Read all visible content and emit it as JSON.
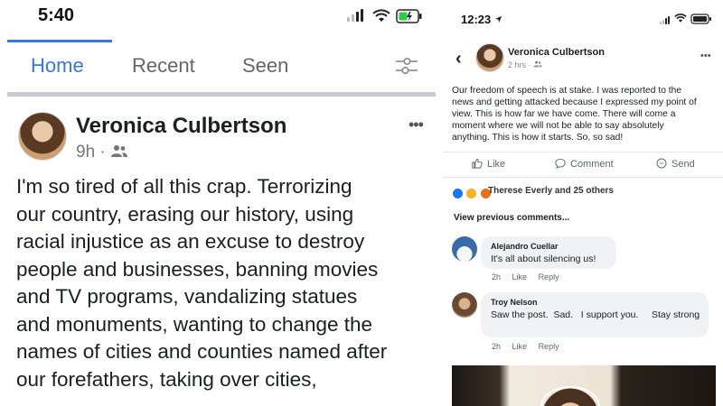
{
  "left_panel": {
    "status_bar": {
      "time": "5:40"
    },
    "tabs": [
      {
        "label": "Home",
        "active": true
      },
      {
        "label": "Recent",
        "active": false
      },
      {
        "label": "Seen",
        "active": false
      }
    ],
    "post": {
      "author": "Veronica Culbertson",
      "time": "9h",
      "separator": "·",
      "audience_icon": "friends-icon",
      "more_label": "•••",
      "lines": [
        "I'm so tired of all this crap. Terrorizing",
        "our country, erasing our history, using",
        "racial injustice as an excuse to destroy",
        "people and businesses, banning movies",
        "and TV programs, vandalizing statues",
        "and monuments, wanting to change the",
        "names of cities and counties named after",
        "our forefathers, taking over cities,"
      ]
    }
  },
  "right_panel": {
    "status_bar": {
      "time": "12:23"
    },
    "back_label": "‹",
    "post": {
      "author": "Veronica Culbertson",
      "time": "2 hrs",
      "separator": "·",
      "audience_icon": "friends-icon",
      "more_label": "•••",
      "lines": [
        "Our freedom of speech is at stake. I was reported to the",
        "news and getting attacked because I expressed my point of",
        "view.  This is how far we have come. There will come a",
        "moment where we will not be able to say absolutely",
        "anything. This is how it starts. So, so sad!"
      ]
    },
    "actions": {
      "like": "Like",
      "comment": "Comment",
      "send": "Send"
    },
    "reactions": {
      "text": "Therese Everly and 25 others",
      "colors": [
        "#1877f2",
        "#f7b125",
        "#e9710f"
      ]
    },
    "view_previous": "View previous comments...",
    "comments": [
      {
        "author": "Alejandro Cuellar",
        "text": "It's all about silencing us!",
        "time": "2h",
        "like": "Like",
        "reply": "Reply"
      },
      {
        "author": "Troy Nelson",
        "text": "Saw the post.  Sad.   I support you.     Stay strong",
        "time": "2h",
        "like": "Like",
        "reply": "Reply"
      }
    ]
  },
  "colors": {
    "accent": "#3578e5",
    "text": "#1c1e21",
    "muted": "#777777",
    "bubble": "#f0f2f5"
  }
}
